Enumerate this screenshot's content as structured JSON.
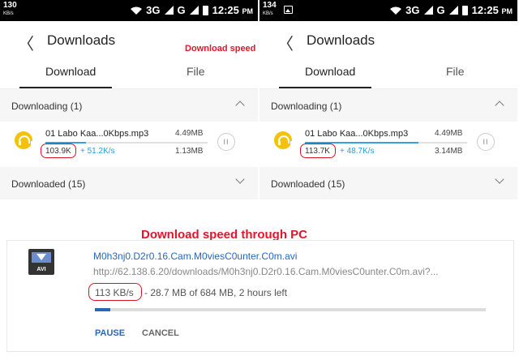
{
  "phones": [
    {
      "status": {
        "speed": "130",
        "unit": "KB/s",
        "network": "3G",
        "g": "G",
        "time": "12:25",
        "ampm": "PM"
      },
      "appbar": {
        "back": "〈",
        "title": "Downloads"
      },
      "caption": "Download speed through mobile",
      "tabs": [
        "Download",
        "File"
      ],
      "downloading": "Downloading (1)",
      "item": {
        "name": "01 Labo Kaa...0Kbps.mp3",
        "size": "4.49MB",
        "downloaded": "103.9K",
        "speed": "+ 51.2K/s",
        "done": "1.13MB",
        "progress": 0.25,
        "pause": "II"
      },
      "downloaded": "Downloaded (15)"
    },
    {
      "status": {
        "speed": "134",
        "unit": "KB/s",
        "network": "3G",
        "g": "G",
        "time": "12:25",
        "ampm": "PM"
      },
      "appbar": {
        "back": "〈",
        "title": "Downloads"
      },
      "tabs": [
        "Download",
        "File"
      ],
      "downloading": "Downloading (1)",
      "item": {
        "name": "01 Labo Kaa...0Kbps.mp3",
        "size": "4.49MB",
        "downloaded": "113.7K",
        "speed": "+ 48.7K/s",
        "done": "3.14MB",
        "progress": 0.7,
        "pause": "II"
      },
      "downloaded": "Downloaded (15)"
    }
  ],
  "pc": {
    "caption": "Download speed through PC",
    "icon_label": "AVI",
    "filename": "M0h3nj0.D2r0.16.Cam.M0viesC0unter.C0m.avi",
    "url": "http://62.138.6.20/downloads/M0h3nj0.D2r0.16.Cam.M0viesC0unter.C0m.avi?...",
    "speed": "113 KB/s",
    "status": "- 28.7 MB of 684 MB, 2 hours left",
    "progress": 0.04,
    "pause": "PAUSE",
    "cancel": "CANCEL"
  },
  "colors": {
    "accent_red": "#e5142a",
    "link_blue": "#2a66b8",
    "progress_blue": "#3aa1e0",
    "headphone_yellow": "#f4c20d"
  }
}
